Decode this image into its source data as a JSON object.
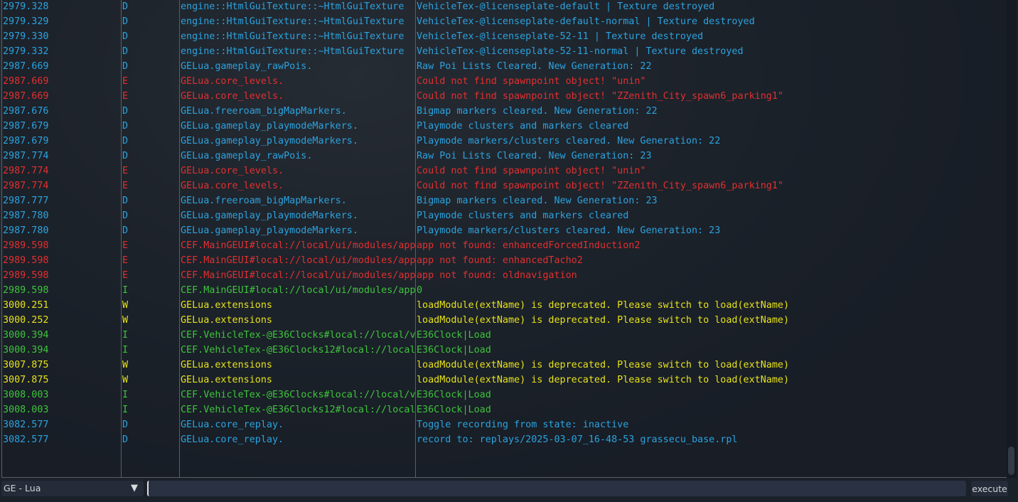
{
  "log": [
    [
      "2979.328",
      "D",
      "engine::HtmlGuiTexture::~HtmlGuiTexture",
      "VehicleTex-@licenseplate-default | Texture destroyed"
    ],
    [
      "2979.329",
      "D",
      "engine::HtmlGuiTexture::~HtmlGuiTexture",
      "VehicleTex-@licenseplate-default-normal | Texture destroyed"
    ],
    [
      "2979.330",
      "D",
      "engine::HtmlGuiTexture::~HtmlGuiTexture",
      "VehicleTex-@licenseplate-52-11 | Texture destroyed"
    ],
    [
      "2979.332",
      "D",
      "engine::HtmlGuiTexture::~HtmlGuiTexture",
      "VehicleTex-@licenseplate-52-11-normal | Texture destroyed"
    ],
    [
      "2987.669",
      "D",
      "GELua.gameplay_rawPois.",
      "Raw Poi Lists Cleared. New Generation: 22"
    ],
    [
      "2987.669",
      "E",
      "GELua.core_levels.",
      "Could not find spawnpoint object! \"unin\""
    ],
    [
      "2987.669",
      "E",
      "GELua.core_levels.",
      "Could not find spawnpoint object! \"ZZenith_City_spawn6_parking1\""
    ],
    [
      "2987.676",
      "D",
      "GELua.freeroam_bigMapMarkers.",
      "Bigmap markers cleared. New Generation: 22"
    ],
    [
      "2987.679",
      "D",
      "GELua.gameplay_playmodeMarkers.",
      "Playmode clusters and markers cleared"
    ],
    [
      "2987.679",
      "D",
      "GELua.gameplay_playmodeMarkers.",
      "Playmode markers/clusters cleared. New Generation: 22"
    ],
    [
      "2987.774",
      "D",
      "GELua.gameplay_rawPois.",
      "Raw Poi Lists Cleared. New Generation: 23"
    ],
    [
      "2987.774",
      "E",
      "GELua.core_levels.",
      "Could not find spawnpoint object! \"unin\""
    ],
    [
      "2987.774",
      "E",
      "GELua.core_levels.",
      "Could not find spawnpoint object! \"ZZenith_City_spawn6_parking1\""
    ],
    [
      "2987.777",
      "D",
      "GELua.freeroam_bigMapMarkers.",
      "Bigmap markers cleared. New Generation: 23"
    ],
    [
      "2987.780",
      "D",
      "GELua.gameplay_playmodeMarkers.",
      "Playmode clusters and markers cleared"
    ],
    [
      "2987.780",
      "D",
      "GELua.gameplay_playmodeMarkers.",
      "Playmode markers/clusters cleared. New Generation: 23"
    ],
    [
      "2989.598",
      "E",
      "CEF.MainGEUI#local://local/ui/modules/app",
      "app not found: enhancedForcedInduction2"
    ],
    [
      "2989.598",
      "E",
      "CEF.MainGEUI#local://local/ui/modules/app",
      "app not found: enhancedTacho2"
    ],
    [
      "2989.598",
      "E",
      "CEF.MainGEUI#local://local/ui/modules/app",
      "app not found: oldnavigation"
    ],
    [
      "2989.598",
      "I",
      "CEF.MainGEUI#local://local/ui/modules/app",
      "0"
    ],
    [
      "3000.251",
      "W",
      "GELua.extensions",
      "loadModule(extName) is deprecated. Please switch to load(extName)"
    ],
    [
      "3000.252",
      "W",
      "GELua.extensions",
      "loadModule(extName) is deprecated. Please switch to load(extName)"
    ],
    [
      "3000.394",
      "I",
      "CEF.VehicleTex-@E36Clocks#local://local/v",
      "E36Clock|Load"
    ],
    [
      "3000.394",
      "I",
      "CEF.VehicleTex-@E36Clocks12#local://local",
      "E36Clock|Load"
    ],
    [
      "3007.875",
      "W",
      "GELua.extensions",
      "loadModule(extName) is deprecated. Please switch to load(extName)"
    ],
    [
      "3007.875",
      "W",
      "GELua.extensions",
      "loadModule(extName) is deprecated. Please switch to load(extName)"
    ],
    [
      "3008.003",
      "I",
      "CEF.VehicleTex-@E36Clocks#local://local/v",
      "E36Clock|Load"
    ],
    [
      "3008.003",
      "I",
      "CEF.VehicleTex-@E36Clocks12#local://local",
      "E36Clock|Load"
    ],
    [
      "3082.577",
      "D",
      "GELua.core_replay.",
      "Toggle recording from state: inactive"
    ],
    [
      "3082.577",
      "D",
      "GELua.core_replay.",
      "record to: replays/2025-03-07_16-48-53 grassecu_base.rpl"
    ]
  ],
  "console": {
    "context": "GE - Lua",
    "command_value": "",
    "execute_label": "execute",
    "dropdown_icon": "triangle-down-icon"
  },
  "colors": {
    "D": "#2ba3df",
    "E": "#e2302f",
    "I": "#3ec43c",
    "W": "#e6e21c"
  }
}
